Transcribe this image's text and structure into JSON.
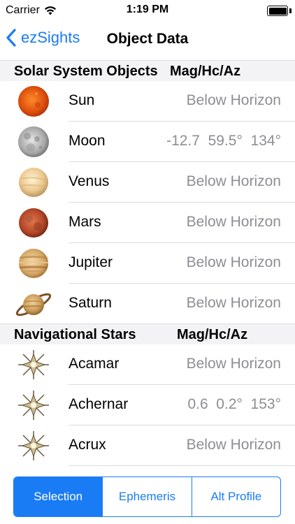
{
  "status": {
    "carrier": "Carrier",
    "time": "1:19 PM"
  },
  "nav": {
    "back_label": "ezSights",
    "title": "Object Data"
  },
  "solar": {
    "header_left": "Solar System Objects",
    "header_right": "Mag/Hc/Az",
    "rows": [
      {
        "name": "Sun",
        "value": "Below Horizon",
        "icon": "sun-icon"
      },
      {
        "name": "Moon",
        "value": "-12.7  59.5°  134°",
        "icon": "moon-icon"
      },
      {
        "name": "Venus",
        "value": "Below Horizon",
        "icon": "venus-icon"
      },
      {
        "name": "Mars",
        "value": "Below Horizon",
        "icon": "mars-icon"
      },
      {
        "name": "Jupiter",
        "value": "Below Horizon",
        "icon": "jupiter-icon"
      },
      {
        "name": "Saturn",
        "value": "Below Horizon",
        "icon": "saturn-icon"
      }
    ]
  },
  "stars": {
    "header_left": "Navigational Stars",
    "header_right": "Mag/Hc/Az",
    "rows": [
      {
        "name": "Acamar",
        "value": "Below Horizon",
        "icon": "star-icon"
      },
      {
        "name": "Achernar",
        "value": "0.6  0.2°  153°",
        "icon": "star-icon"
      },
      {
        "name": "Acrux",
        "value": "Below Horizon",
        "icon": "star-icon"
      }
    ]
  },
  "tabs": {
    "items": [
      "Selection",
      "Ephemeris",
      "Alt Profile"
    ],
    "active": "Selection"
  },
  "colors": {
    "accent": "#1a7cf5",
    "secondary_text": "#8e8e93",
    "section_bg": "#f3f3f5"
  }
}
